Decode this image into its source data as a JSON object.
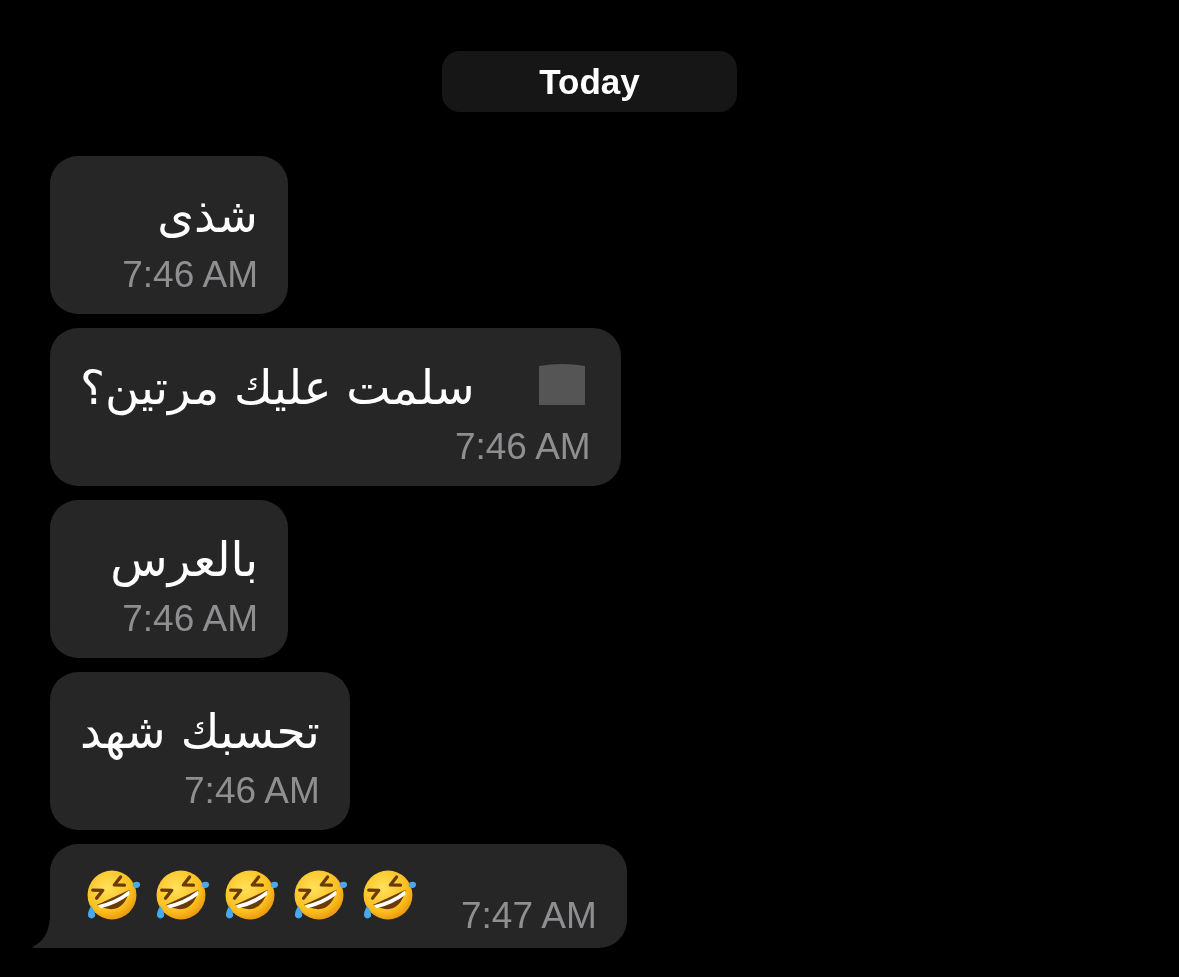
{
  "date_divider": {
    "label": "Today"
  },
  "messages": [
    {
      "kind": "text",
      "text": "شذى",
      "time": "7:46 AM",
      "leading_icon": false,
      "tail": false
    },
    {
      "kind": "text",
      "text": "سلمت عليك مرتين؟",
      "time": "7:46 AM",
      "leading_icon": true,
      "tail": false
    },
    {
      "kind": "text",
      "text": "بالعرس",
      "time": "7:46 AM",
      "leading_icon": false,
      "tail": false
    },
    {
      "kind": "text",
      "text": "تحسبك شهد",
      "time": "7:46 AM",
      "leading_icon": false,
      "tail": false
    },
    {
      "kind": "emoji",
      "emojis": [
        {
          "kind": "rofl"
        },
        {
          "kind": "rofl"
        },
        {
          "kind": "rofl"
        },
        {
          "kind": "rofl"
        },
        {
          "kind": "rofl"
        }
      ],
      "time": "7:47 AM",
      "leading_icon": false,
      "tail": true
    }
  ]
}
